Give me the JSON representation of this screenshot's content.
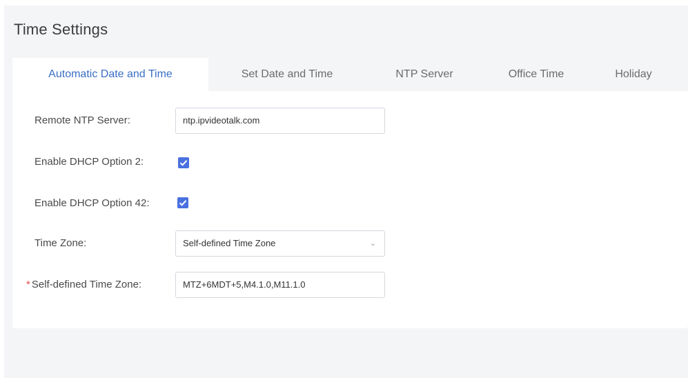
{
  "page": {
    "title": "Time Settings"
  },
  "tabs": [
    {
      "label": "Automatic Date and Time",
      "active": true
    },
    {
      "label": "Set Date and Time",
      "active": false
    },
    {
      "label": "NTP Server",
      "active": false
    },
    {
      "label": "Office Time",
      "active": false
    },
    {
      "label": "Holiday",
      "active": false
    }
  ],
  "form": {
    "remote_ntp": {
      "label": "Remote NTP Server:",
      "value": "ntp.ipvideotalk.com"
    },
    "dhcp2": {
      "label": "Enable DHCP Option 2:",
      "checked": true
    },
    "dhcp42": {
      "label": "Enable DHCP Option 42:",
      "checked": true
    },
    "time_zone": {
      "label": "Time Zone:",
      "value": "Self-defined Time Zone",
      "chevron": "⌄"
    },
    "self_tz": {
      "required_mark": "*",
      "label": "Self-defined Time Zone:",
      "value": "MTZ+6MDT+5,M4.1.0,M11.1.0"
    }
  },
  "colors": {
    "accent": "#3a6ec4",
    "checkbox": "#4a70e0",
    "background": "#f4f5f7"
  }
}
